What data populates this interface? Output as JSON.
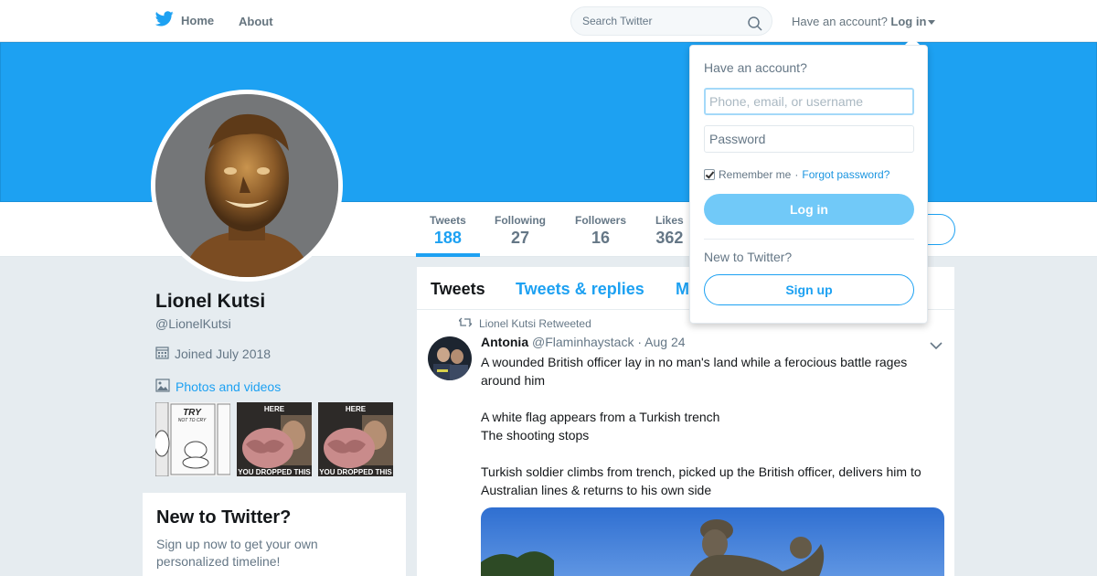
{
  "nav": {
    "home_label": "Home",
    "about_label": "About",
    "search_placeholder": "Search Twitter",
    "have_account": "Have an account?",
    "login_label": "Log in"
  },
  "profile": {
    "name": "Lionel Kutsi",
    "handle": "@LionelKutsi",
    "joined": "Joined July 2018",
    "photos_label": "Photos and videos",
    "stats": [
      {
        "label": "Tweets",
        "value": "188"
      },
      {
        "label": "Following",
        "value": "27"
      },
      {
        "label": "Followers",
        "value": "16"
      },
      {
        "label": "Likes",
        "value": "362"
      }
    ],
    "thumb_captions": [
      "TRY",
      "NOT TO CRY",
      "HERE",
      "YOU DROPPED THIS",
      "HERE",
      "YOU DROPPED THIS"
    ]
  },
  "new_module": {
    "title": "New to Twitter?",
    "text": "Sign up now to get your own personalized timeline!"
  },
  "timeline": {
    "tabs": [
      "Tweets",
      "Tweets & replies",
      "M"
    ],
    "tweet": {
      "retweet_context": "Lionel Kutsi Retweeted",
      "author_name": "Antonia",
      "author_handle": "@Flaminhaystack",
      "date": "· Aug 24",
      "lines": [
        "A wounded British officer lay in no man's land while a ferocious battle rages around him",
        "",
        "A white flag appears from a Turkish trench",
        "The shooting stops",
        "",
        "Turkish soldier climbs from trench, picked up the British officer, delivers him to Australian lines & returns to his own side"
      ]
    }
  },
  "login_dropdown": {
    "title": "Have an account?",
    "username_placeholder": "Phone, email, or username",
    "password_placeholder": "Password",
    "remember_label": "Remember me",
    "separator": "·",
    "forgot_label": "Forgot password?",
    "login_button": "Log in",
    "new_label": "New to Twitter?",
    "signup_button": "Sign up"
  },
  "colors": {
    "brand": "#1da1f2",
    "background": "#e6ecf0"
  }
}
